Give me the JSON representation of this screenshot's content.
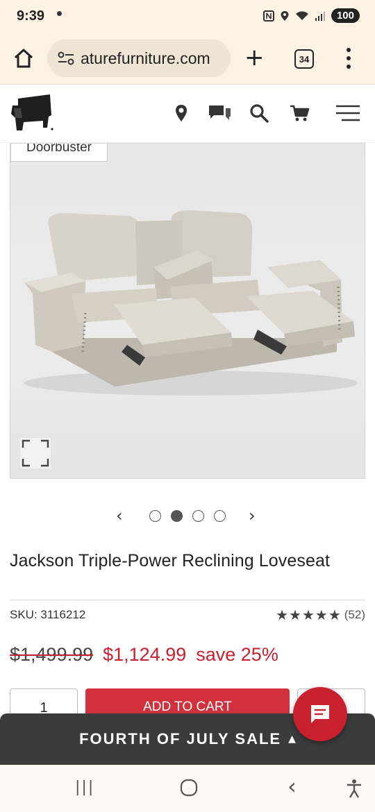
{
  "status_bar": {
    "time": "9:39",
    "battery": "100",
    "icons": [
      "nfc-icon",
      "location-icon",
      "wifi-icon",
      "signal-icon"
    ]
  },
  "browser": {
    "url": "aturefurniture.com",
    "tab_count": "34"
  },
  "header": {
    "icons": [
      "location-pin-icon",
      "chat-icon",
      "search-icon",
      "cart-icon",
      "hamburger-menu-icon"
    ]
  },
  "product": {
    "badge": "Doorbuster",
    "title": "Jackson Triple-Power Reclining Loveseat",
    "sku": "SKU: 3116212",
    "stars": "★★★★★",
    "review_count": "(52)",
    "original_price": "$1,499.99",
    "sale_price": "$1,124.99",
    "save_text": "save 25%",
    "quantity": "1",
    "add_to_cart_label": "ADD TO CART",
    "image_count": 4,
    "active_image": 2,
    "rating": 5
  },
  "carousel": {
    "prev_glyph": "‹",
    "next_glyph": "›"
  },
  "promo": {
    "banner_text": "FOURTH OF JULY SALE",
    "caret": "▲"
  },
  "android_nav": {
    "recents_glyph": "|||",
    "back_glyph": "‹"
  },
  "colors": {
    "brand_red": "#c8202f",
    "browser_bg": "#fcf2e3",
    "banner_bg": "#3b3b3b"
  }
}
